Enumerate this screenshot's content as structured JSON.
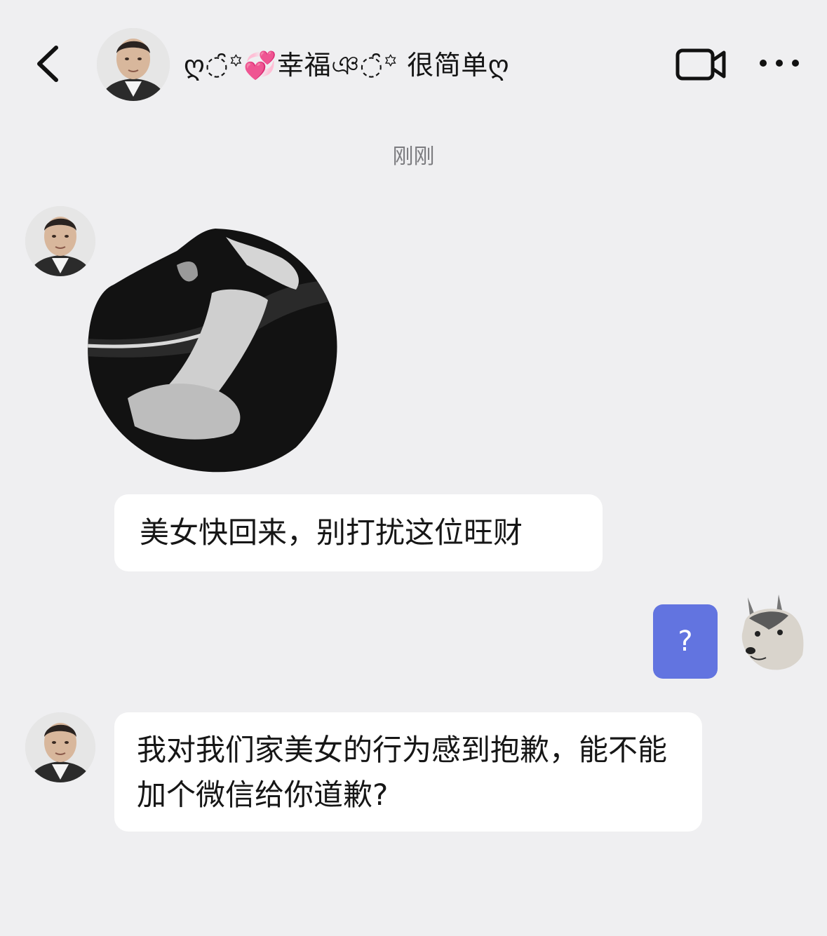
{
  "header": {
    "contact_name": "ღ◌̑꙳💞幸福ঞ◌̑꙳ 很简单ღ",
    "back_icon": "chevron-left-icon",
    "video_icon": "video-camera-icon",
    "more_icon": "more-dots-icon"
  },
  "timestamp": "刚刚",
  "messages": [
    {
      "sender": "contact",
      "type": "sticker",
      "description_icon": "sticker-image"
    },
    {
      "sender": "contact",
      "type": "text",
      "text": "美女快回来，别打扰这位旺财"
    },
    {
      "sender": "me",
      "type": "text",
      "text": "?"
    },
    {
      "sender": "contact",
      "type": "text",
      "text": "我对我们家美女的行为感到抱歉，能不能加个微信给你道歉?"
    }
  ],
  "colors": {
    "background": "#efeff1",
    "bubble_incoming": "#ffffff",
    "bubble_outgoing": "#6274e0",
    "timestamp": "#7c7c80"
  }
}
